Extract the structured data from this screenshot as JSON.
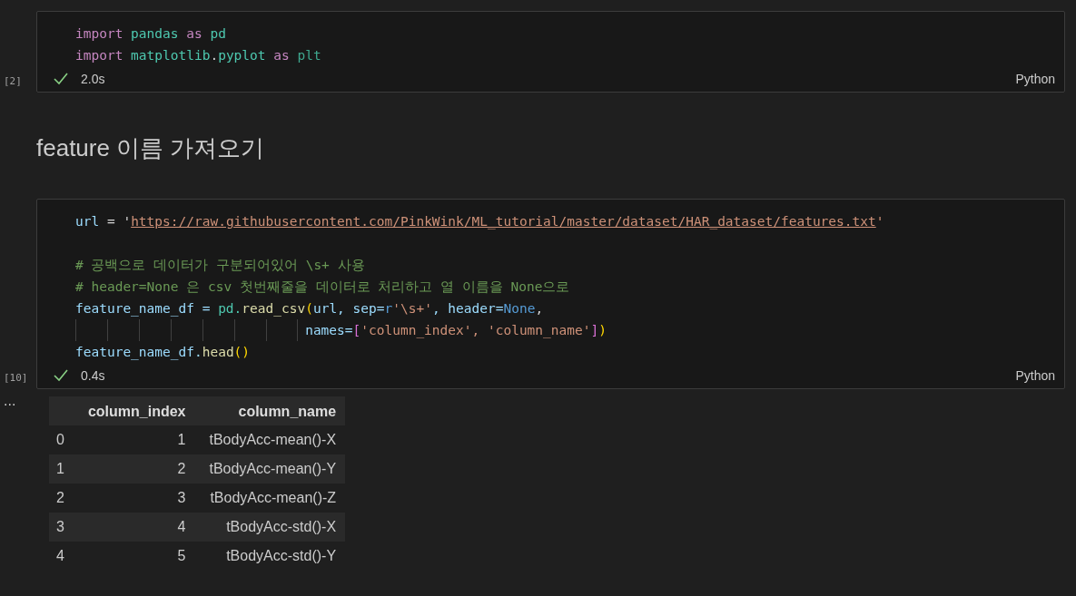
{
  "cells": [
    {
      "kind": "code",
      "count": "[2]",
      "status": "2.0s",
      "success": true,
      "language": "Python",
      "lines": [
        {
          "kind": "code",
          "tokens": [
            {
              "text": "import ",
              "kind": "keyword"
            },
            {
              "text": "pandas ",
              "kind": "module"
            },
            {
              "text": "as ",
              "kind": "keyword"
            },
            {
              "text": "pd",
              "kind": "module"
            }
          ]
        },
        {
          "kind": "code",
          "tokens": [
            {
              "text": "import ",
              "kind": "keyword"
            },
            {
              "text": "matplotlib",
              "kind": "module"
            },
            {
              "text": ".",
              "kind": "plain"
            },
            {
              "text": "pyplot ",
              "kind": "module"
            },
            {
              "text": "as ",
              "kind": "keyword"
            },
            {
              "text": "plt",
              "kind": "alias"
            }
          ]
        }
      ]
    },
    {
      "kind": "markdown",
      "heading": "feature 이름 가져오기"
    },
    {
      "kind": "code",
      "count": "[10]",
      "status": "0.4s",
      "success": true,
      "language": "Python",
      "lines": [
        {
          "kind": "code",
          "tokens": [
            {
              "text": "url",
              "kind": "variable"
            },
            {
              "text": " = '",
              "kind": "plain"
            },
            {
              "text": "https://raw.githubusercontent.com/PinkWink/ML_tutorial/master/dataset/HAR_dataset/features.txt",
              "kind": "link"
            },
            {
              "text": "'",
              "kind": "string"
            }
          ]
        },
        {
          "kind": "blank"
        },
        {
          "kind": "code",
          "tokens": [
            {
              "text": "# 공백으로 데이터가 구분되어있어 \\s+ 사용",
              "kind": "comment"
            }
          ]
        },
        {
          "kind": "code",
          "tokens": [
            {
              "text": "# header=None 은 csv 첫번째줄을 데이터로 처리하고 열 이름을 None으로",
              "kind": "comment"
            }
          ]
        },
        {
          "kind": "code",
          "tokens": [
            {
              "text": "feature_name_df = ",
              "kind": "variable"
            },
            {
              "text": "pd.",
              "kind": "module"
            },
            {
              "text": "read_csv",
              "kind": "function"
            },
            {
              "text": "(",
              "kind": "bracket1"
            },
            {
              "text": "url, sep=",
              "kind": "variable"
            },
            {
              "text": "r",
              "kind": "const"
            },
            {
              "text": "'\\s+'",
              "kind": "string"
            },
            {
              "text": ", header=",
              "kind": "variable"
            },
            {
              "text": "None",
              "kind": "const"
            },
            {
              "text": ",",
              "kind": "plain"
            }
          ]
        },
        {
          "kind": "continuation",
          "tokens": [
            {
              "text": "names=",
              "kind": "variable"
            },
            {
              "text": "[",
              "kind": "bracket2"
            },
            {
              "text": "'column_index', 'column_name'",
              "kind": "string"
            },
            {
              "text": "]",
              "kind": "bracket2"
            },
            {
              "text": ")",
              "kind": "bracket1"
            }
          ]
        },
        {
          "kind": "code",
          "tokens": [
            {
              "text": "feature_name_df.",
              "kind": "variable"
            },
            {
              "text": "head",
              "kind": "function"
            },
            {
              "text": "()",
              "kind": "bracket1"
            }
          ]
        }
      ],
      "output": {
        "more": "...",
        "columns": [
          "column_index",
          "column_name"
        ],
        "rows": [
          {
            "index": "0",
            "cells": [
              "1",
              "tBodyAcc-mean()-X"
            ]
          },
          {
            "index": "1",
            "cells": [
              "2",
              "tBodyAcc-mean()-Y"
            ]
          },
          {
            "index": "2",
            "cells": [
              "3",
              "tBodyAcc-mean()-Z"
            ]
          },
          {
            "index": "3",
            "cells": [
              "4",
              "tBodyAcc-std()-X"
            ]
          },
          {
            "index": "4",
            "cells": [
              "5",
              "tBodyAcc-std()-Y"
            ]
          }
        ]
      }
    }
  ]
}
